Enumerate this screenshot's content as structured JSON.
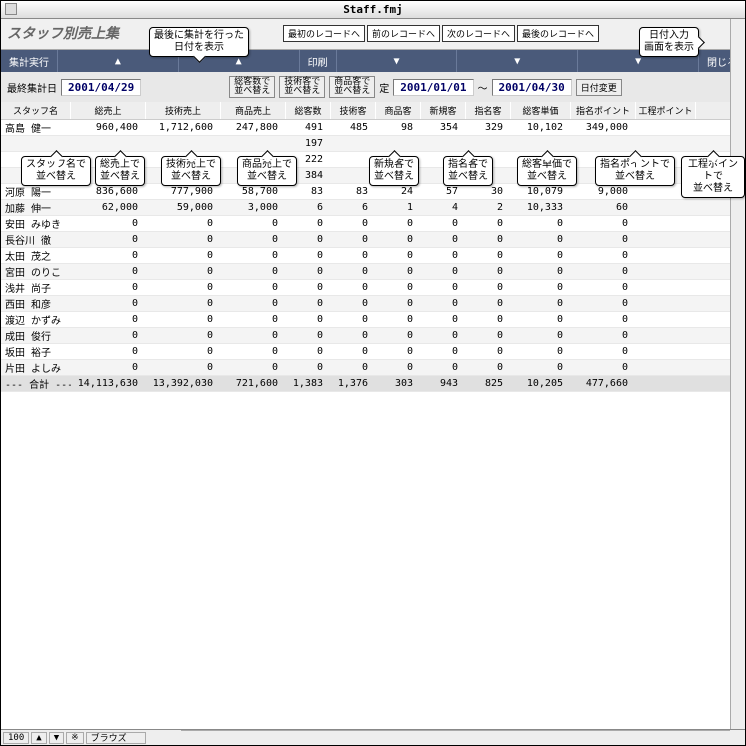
{
  "window": {
    "title": "Staff.fmj"
  },
  "header": {
    "page_title": "スタッフ別売上集",
    "nav": {
      "first": "最初のレコードへ",
      "prev": "前のレコードへ",
      "next": "次のレコードへ",
      "last": "最後のレコードへ"
    }
  },
  "darkbar": {
    "exec": "集計実行",
    "print": "印刷",
    "close": "閉じる"
  },
  "date_row": {
    "label": "最終集計日",
    "last_date": "2001/04/29",
    "range_label": "定",
    "from": "2001/01/01",
    "sep": "～",
    "to": "2001/04/30",
    "change": "日付変更",
    "sort_btns": {
      "cust": "総客数で\n並べ替え",
      "tech": "技術客で\n並べ替え",
      "prod": "商品客で\n並べ替え"
    }
  },
  "columns": [
    "スタッフ名",
    "総売上",
    "技術売上",
    "商品売上",
    "総客数",
    "技術客",
    "商品客",
    "新規客",
    "指名客",
    "総客単価",
    "指名ポイント",
    "工程ポイント"
  ],
  "rows": [
    {
      "n": "高島 健一",
      "v": [
        "960,400",
        "1,712,600",
        "247,800",
        "491",
        "485",
        "98",
        "354",
        "329",
        "10,102",
        "349,000",
        ""
      ]
    },
    {
      "n": "",
      "v": [
        "",
        "",
        "",
        "197",
        "",
        "",
        "",
        "",
        "",
        "",
        ""
      ]
    },
    {
      "n": "",
      "v": [
        "",
        "",
        "",
        "222",
        "",
        "",
        "",
        "",
        "",
        "",
        ""
      ]
    },
    {
      "n": "",
      "v": [
        "",
        "",
        "",
        "384",
        "",
        "",
        "",
        "",
        "",
        "",
        ""
      ]
    },
    {
      "n": "河原 陽一",
      "v": [
        "836,600",
        "777,900",
        "58,700",
        "83",
        "83",
        "24",
        "57",
        "30",
        "10,079",
        "9,000",
        ""
      ]
    },
    {
      "n": "加藤 伸一",
      "v": [
        "62,000",
        "59,000",
        "3,000",
        "6",
        "6",
        "1",
        "4",
        "2",
        "10,333",
        "60",
        ""
      ]
    },
    {
      "n": "安田 みゆき",
      "v": [
        "0",
        "0",
        "0",
        "0",
        "0",
        "0",
        "0",
        "0",
        "0",
        "0",
        ""
      ]
    },
    {
      "n": "長谷川 徹",
      "v": [
        "0",
        "0",
        "0",
        "0",
        "0",
        "0",
        "0",
        "0",
        "0",
        "0",
        ""
      ]
    },
    {
      "n": "太田 茂之",
      "v": [
        "0",
        "0",
        "0",
        "0",
        "0",
        "0",
        "0",
        "0",
        "0",
        "0",
        ""
      ]
    },
    {
      "n": "宮田 のりこ",
      "v": [
        "0",
        "0",
        "0",
        "0",
        "0",
        "0",
        "0",
        "0",
        "0",
        "0",
        ""
      ]
    },
    {
      "n": "浅井 尚子",
      "v": [
        "0",
        "0",
        "0",
        "0",
        "0",
        "0",
        "0",
        "0",
        "0",
        "0",
        ""
      ]
    },
    {
      "n": "西田 和彦",
      "v": [
        "0",
        "0",
        "0",
        "0",
        "0",
        "0",
        "0",
        "0",
        "0",
        "0",
        ""
      ]
    },
    {
      "n": "渡辺 かずみ",
      "v": [
        "0",
        "0",
        "0",
        "0",
        "0",
        "0",
        "0",
        "0",
        "0",
        "0",
        ""
      ]
    },
    {
      "n": "成田 俊行",
      "v": [
        "0",
        "0",
        "0",
        "0",
        "0",
        "0",
        "0",
        "0",
        "0",
        "0",
        ""
      ]
    },
    {
      "n": "坂田 裕子",
      "v": [
        "0",
        "0",
        "0",
        "0",
        "0",
        "0",
        "0",
        "0",
        "0",
        "0",
        ""
      ]
    },
    {
      "n": "片田 よしみ",
      "v": [
        "0",
        "0",
        "0",
        "0",
        "0",
        "0",
        "0",
        "0",
        "0",
        "0",
        ""
      ]
    }
  ],
  "total": {
    "label": "--- 合計 ---",
    "v": [
      "14,113,630",
      "13,392,030",
      "721,600",
      "1,383",
      "1,376",
      "303",
      "943",
      "825",
      "10,205",
      "477,660",
      ""
    ]
  },
  "statusbar": {
    "zoom": "100",
    "mode": "ブラウズ"
  },
  "callouts": {
    "last_date": "最後に集計を行った\n日付を表示",
    "date_input": "日付入力\n画面を表示",
    "sort_staff": "スタッフ名で\n並べ替え",
    "sort_total": "総売上で\n並べ替え",
    "sort_tech": "技術売上で\n並べ替え",
    "sort_prod": "商品売上で\n並べ替え",
    "sort_new": "新規客で\n並べ替え",
    "sort_named": "指名客で\n並べ替え",
    "sort_unit": "総客単価で\n並べ替え",
    "sort_pt": "指名ポイントで\n並べ替え",
    "sort_proc": "工程ポイントで\n並べ替え"
  }
}
